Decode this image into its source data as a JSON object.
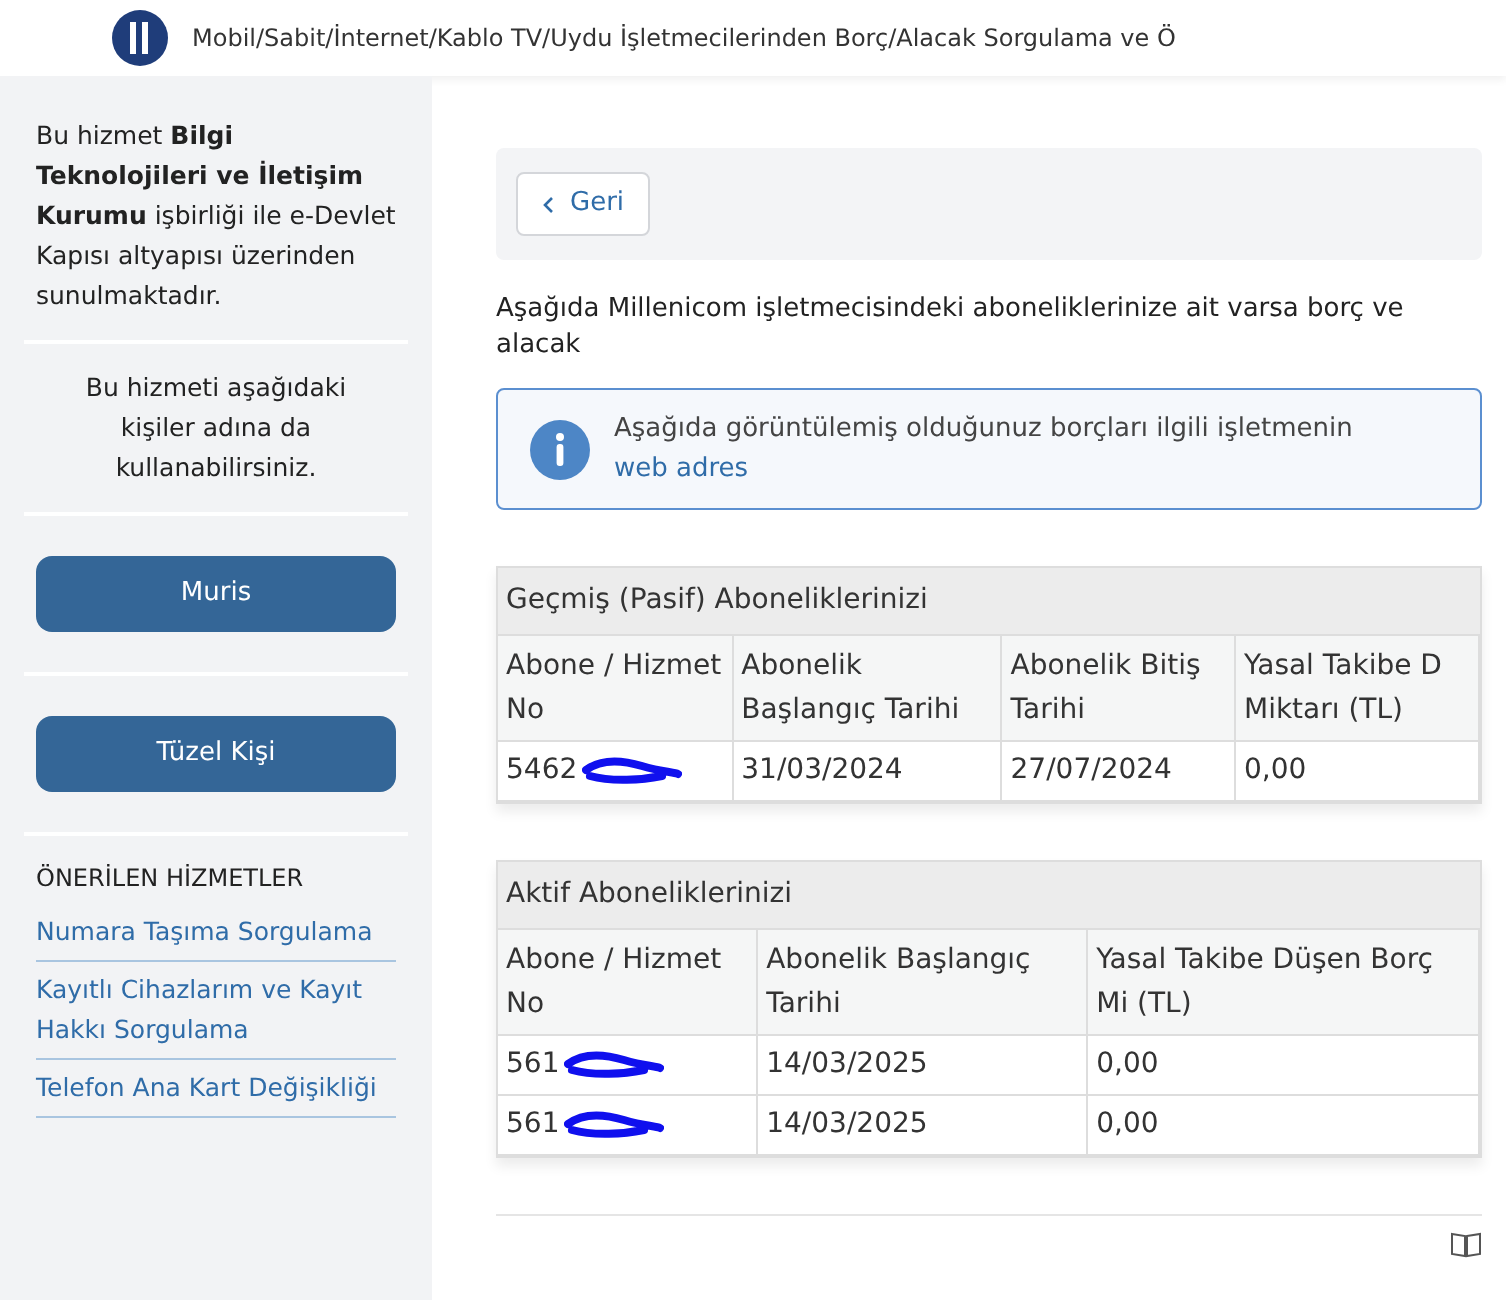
{
  "header": {
    "title": "Mobil/Sabit/İnternet/Kablo TV/Uydu İşletmecilerinden Borç/Alacak Sorgulama ve Ö"
  },
  "sidebar": {
    "info": "Bu hizmet **Bilgi Teknolojileri ve İletişim Kurumu** işbirliği ile e-Devlet Kapısı altyapısı üzerinden sunulmaktadır.",
    "on_behalf": "Bu hizmeti aşağıdaki kişiler adına da kullanabilirsiniz.",
    "buttons": [
      "Muris",
      "Tüzel Kişi"
    ],
    "suggested_title": "ÖNERİLEN HİZMETLER",
    "suggested": [
      "Numara Taşıma Sorgulama",
      "Kayıtlı Cihazlarım ve Kayıt Hakkı Sorgulama",
      "Telefon Ana Kart Değişikliği"
    ]
  },
  "back_button": "Geri",
  "intro": "Aşağıda Millenicom işletmecisindeki aboneliklerinize ait varsa borç ve alacak",
  "notice": {
    "text": "Aşağıda görüntülemiş olduğunuz borçları ilgili işletmenin",
    "link": "web adres"
  },
  "tables": [
    {
      "title": "Geçmiş (Pasif) Aboneliklerinizi",
      "columns": [
        "Abone / Hizmet No",
        "Abonelik Başlangıç Tarihi",
        "Abonelik Bitiş Tarihi",
        "Yasal Takibe D Miktarı (TL)"
      ],
      "rows": [
        {
          "redacted": true,
          "cells": [
            "5462",
            "31/03/2024",
            "27/07/2024",
            "0,00"
          ]
        }
      ]
    },
    {
      "title": "Aktif Aboneliklerinizi",
      "columns": [
        "Abone / Hizmet No",
        "Abonelik Başlangıç Tarihi",
        "Yasal Takibe Düşen Borç Mi (TL)"
      ],
      "rows": [
        {
          "redacted": true,
          "cells": [
            "561",
            "14/03/2025",
            "0,00"
          ]
        },
        {
          "redacted": true,
          "cells": [
            "561",
            "14/03/2025",
            "0,00"
          ]
        }
      ]
    }
  ]
}
